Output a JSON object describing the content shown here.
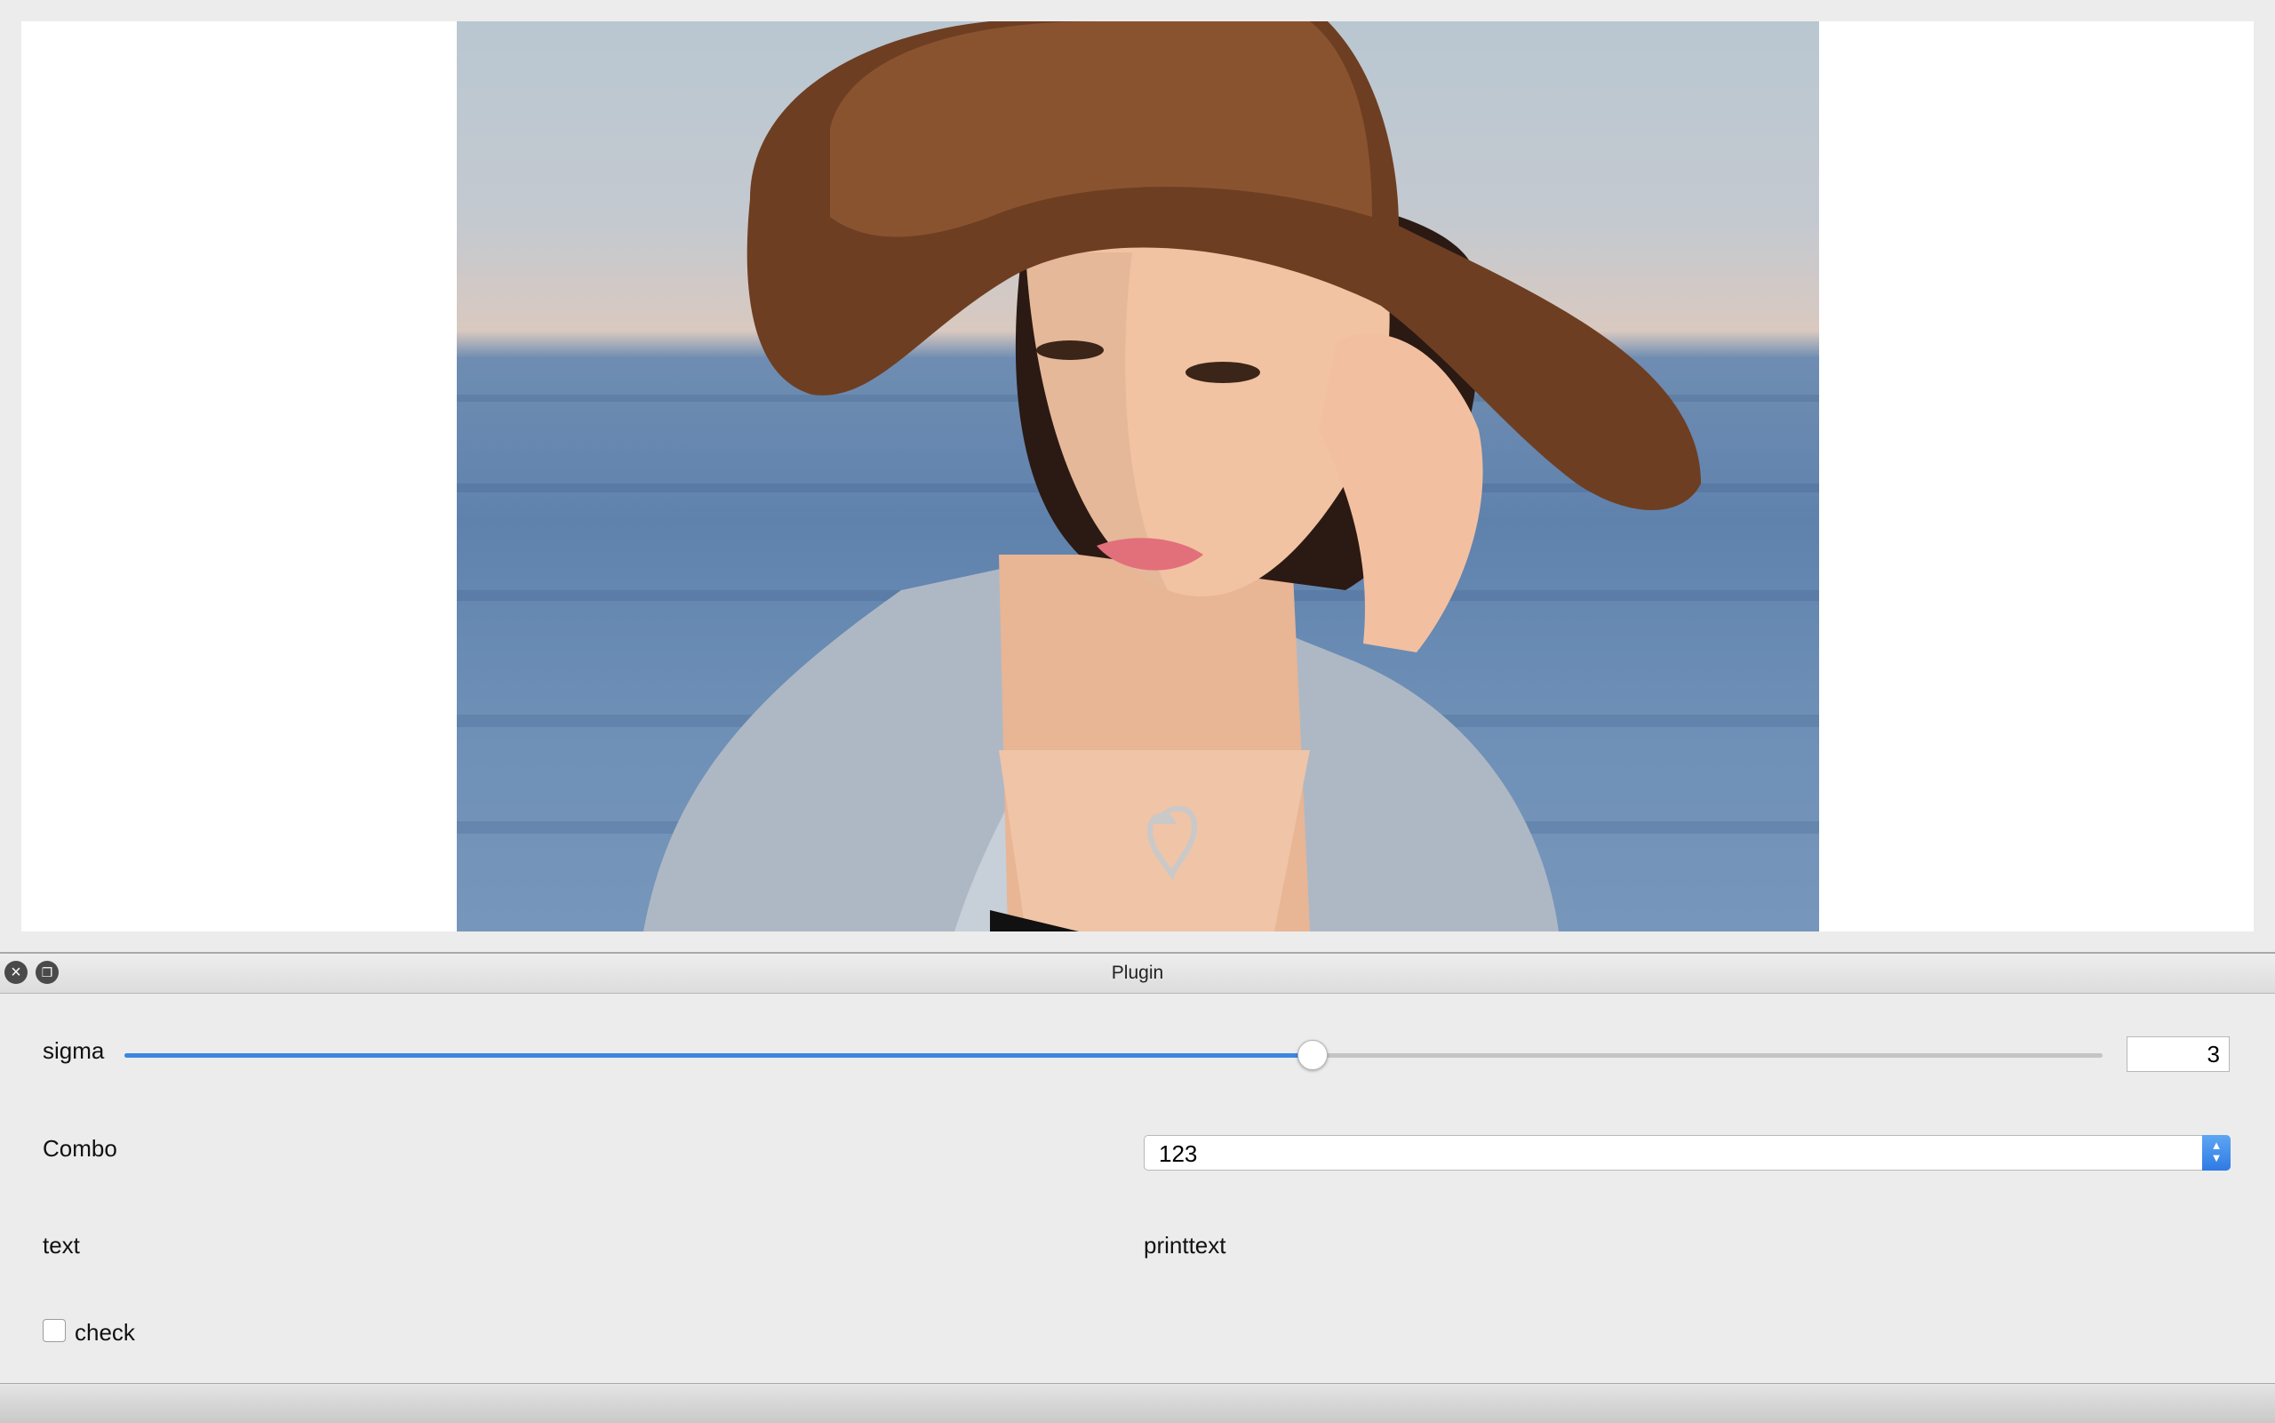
{
  "panel": {
    "title": "Plugin",
    "close_icon": "close-icon",
    "float_icon": "float-window-icon"
  },
  "controls": {
    "sigma": {
      "label": "sigma",
      "value": "3",
      "fraction": 0.6
    },
    "combo": {
      "label": "Combo",
      "selected": "123"
    },
    "text": {
      "label": "text",
      "value": "printtext"
    },
    "check": {
      "label": "check",
      "checked": false
    }
  },
  "colors": {
    "accent": "#3b86e3",
    "panel_bg": "#ececec",
    "viewer_bg": "#ffffff"
  }
}
